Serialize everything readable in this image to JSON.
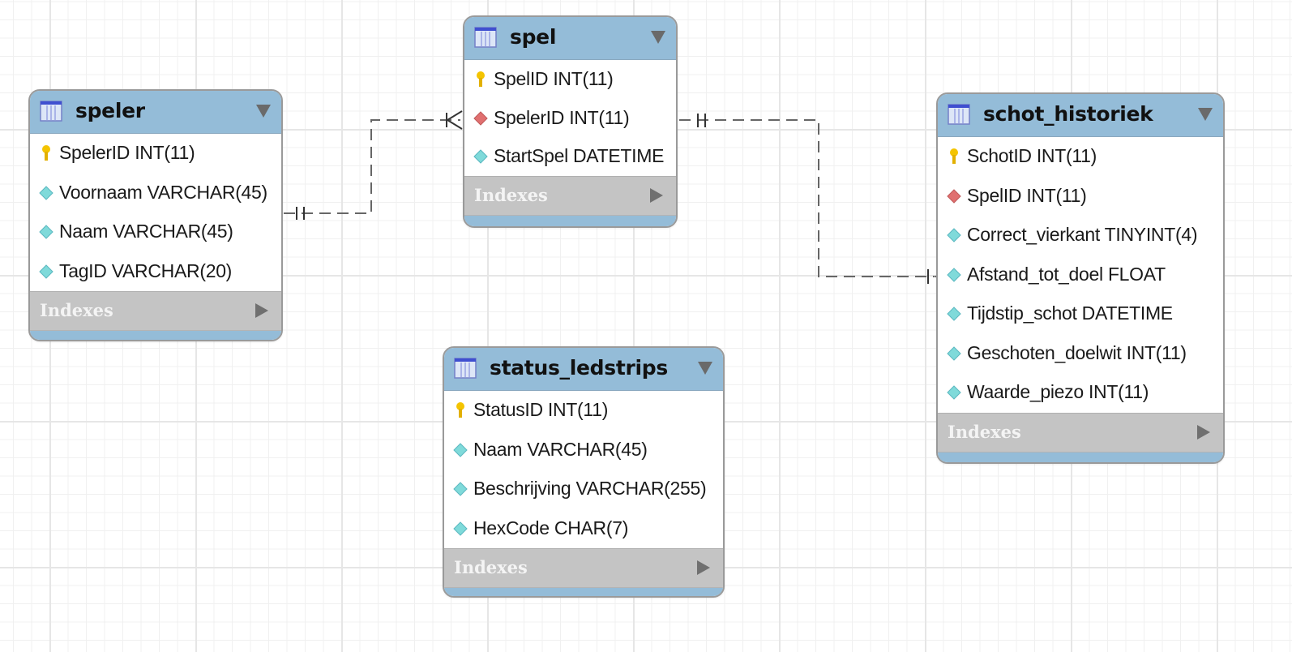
{
  "diagram": {
    "type": "EER diagram",
    "tables": [
      {
        "id": "speler",
        "name": "speler",
        "columns": [
          {
            "name": "SpelerID",
            "type": "INT(11)",
            "key": "primary"
          },
          {
            "name": "Voornaam",
            "type": "VARCHAR(45)",
            "key": "none"
          },
          {
            "name": "Naam",
            "type": "VARCHAR(45)",
            "key": "none"
          },
          {
            "name": "TagID",
            "type": "VARCHAR(20)",
            "key": "none"
          }
        ],
        "indexes_label": "Indexes"
      },
      {
        "id": "spel",
        "name": "spel",
        "columns": [
          {
            "name": "SpelID",
            "type": "INT(11)",
            "key": "primary"
          },
          {
            "name": "SpelerID",
            "type": "INT(11)",
            "key": "foreign"
          },
          {
            "name": "StartSpel",
            "type": "DATETIME",
            "key": "none"
          }
        ],
        "indexes_label": "Indexes"
      },
      {
        "id": "schot_historiek",
        "name": "schot_historiek",
        "columns": [
          {
            "name": "SchotID",
            "type": "INT(11)",
            "key": "primary"
          },
          {
            "name": "SpelID",
            "type": "INT(11)",
            "key": "foreign"
          },
          {
            "name": "Correct_vierkant",
            "type": "TINYINT(4)",
            "key": "none"
          },
          {
            "name": "Afstand_tot_doel",
            "type": "FLOAT",
            "key": "none"
          },
          {
            "name": "Tijdstip_schot",
            "type": "DATETIME",
            "key": "none"
          },
          {
            "name": "Geschoten_doelwit",
            "type": "INT(11)",
            "key": "none"
          },
          {
            "name": "Waarde_piezo",
            "type": "INT(11)",
            "key": "none"
          }
        ],
        "indexes_label": "Indexes"
      },
      {
        "id": "status_ledstrips",
        "name": "status_ledstrips",
        "columns": [
          {
            "name": "StatusID",
            "type": "INT(11)",
            "key": "primary"
          },
          {
            "name": "Naam",
            "type": "VARCHAR(45)",
            "key": "none"
          },
          {
            "name": "Beschrijving",
            "type": "VARCHAR(255)",
            "key": "none"
          },
          {
            "name": "HexCode",
            "type": "CHAR(7)",
            "key": "none"
          }
        ],
        "indexes_label": "Indexes"
      }
    ],
    "relationships": [
      {
        "from": "speler",
        "from_column": "SpelerID",
        "to": "spel",
        "to_column": "SpelerID",
        "from_cardinality": "one-and-only-one",
        "to_cardinality": "one-or-many",
        "style": "dashed"
      },
      {
        "from": "spel",
        "from_column": "SpelID",
        "to": "schot_historiek",
        "to_column": "SpelID",
        "from_cardinality": "one-and-only-one",
        "to_cardinality": "one-or-many",
        "style": "dashed"
      }
    ],
    "icons": {
      "table": "table-icon",
      "primary_key": "key-icon",
      "foreign_key": "red-diamond-icon",
      "column": "cyan-diamond-icon",
      "collapse": "triangle-down-icon",
      "expand_indexes": "triangle-right-icon"
    },
    "colors": {
      "header": "#94bcd8",
      "indexes_bar": "#c4c4c4",
      "primary_key": "#f2c200",
      "foreign_key": "#e07070",
      "column": "#7fdada",
      "connector": "#555555"
    }
  }
}
